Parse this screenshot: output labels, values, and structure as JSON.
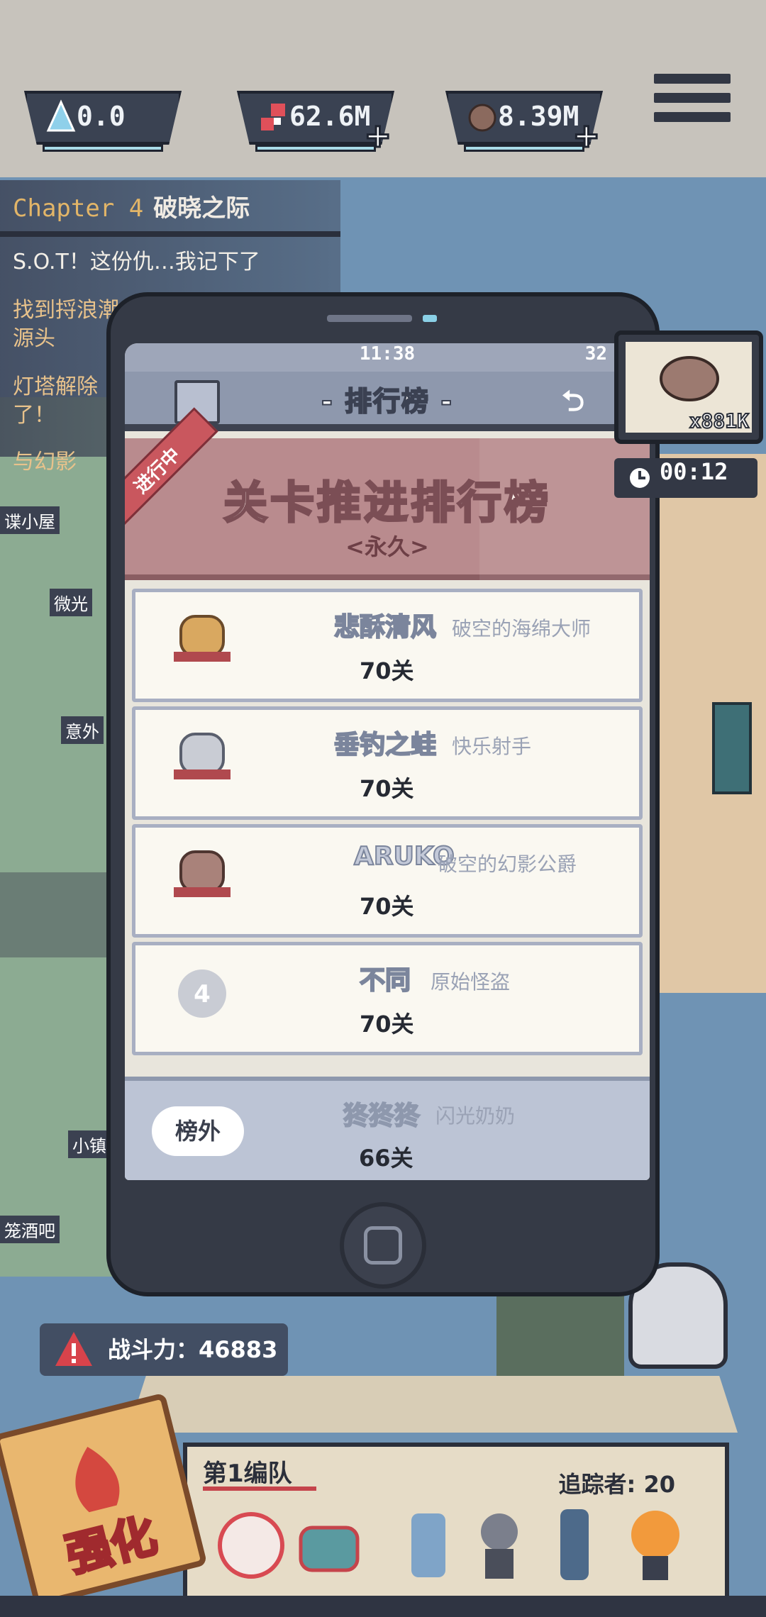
{
  "resources": [
    {
      "id": "crystal",
      "icon": "crystal-icon",
      "value": "0.0",
      "has_plus": false
    },
    {
      "id": "meat",
      "icon": "meat-icon",
      "value": "62.6M",
      "has_plus": true
    },
    {
      "id": "ore",
      "icon": "ore-icon",
      "value": "8.39M",
      "has_plus": true
    }
  ],
  "quest": {
    "chapter": "Chapter 4",
    "chapter_name": "破晓之际",
    "lines": [
      "S.O.T！这份仇…我记下了",
      "找到捋浪潮",
      "源头",
      "灯塔解除",
      "了！",
      "与幻影"
    ]
  },
  "map_labels": [
    "谍小屋",
    "微光",
    "意外",
    "小镇",
    "笼酒吧"
  ],
  "phone": {
    "status_time": "11:38",
    "status_battery": "32",
    "nav_title": "- 排行榜 -",
    "banner_title": "关卡推进排行榜",
    "banner_sub": "<永久>",
    "ribbon": "进行中",
    "rows": [
      {
        "rank": "1",
        "name": "悲酥清风",
        "title": "破空的海绵大师",
        "score": "70关"
      },
      {
        "rank": "2",
        "name": "垂钓之蛙",
        "title": "快乐射手",
        "score": "70关"
      },
      {
        "rank": "3",
        "name": "ARUKO",
        "title": "破空的幻影公爵",
        "score": "70关"
      },
      {
        "rank": "4",
        "name": "不同",
        "title": "原始怪盗",
        "score": "70关"
      }
    ],
    "self": {
      "rank_label": "榜外",
      "name": "㹣㹣㹣",
      "title": "闪光奶奶",
      "score": "66关"
    }
  },
  "drop": {
    "count": "x881K",
    "timer": "00:12"
  },
  "power": {
    "label": "战斗力：46883"
  },
  "squad": {
    "name": "第1编队",
    "trackers": "追踪者: 20"
  },
  "enhance": {
    "label": "强化"
  },
  "colors": {
    "map_water": "#6f93b4",
    "panel": "#353a46",
    "banner": "#b98b8e",
    "accent_red": "#c5444b"
  }
}
